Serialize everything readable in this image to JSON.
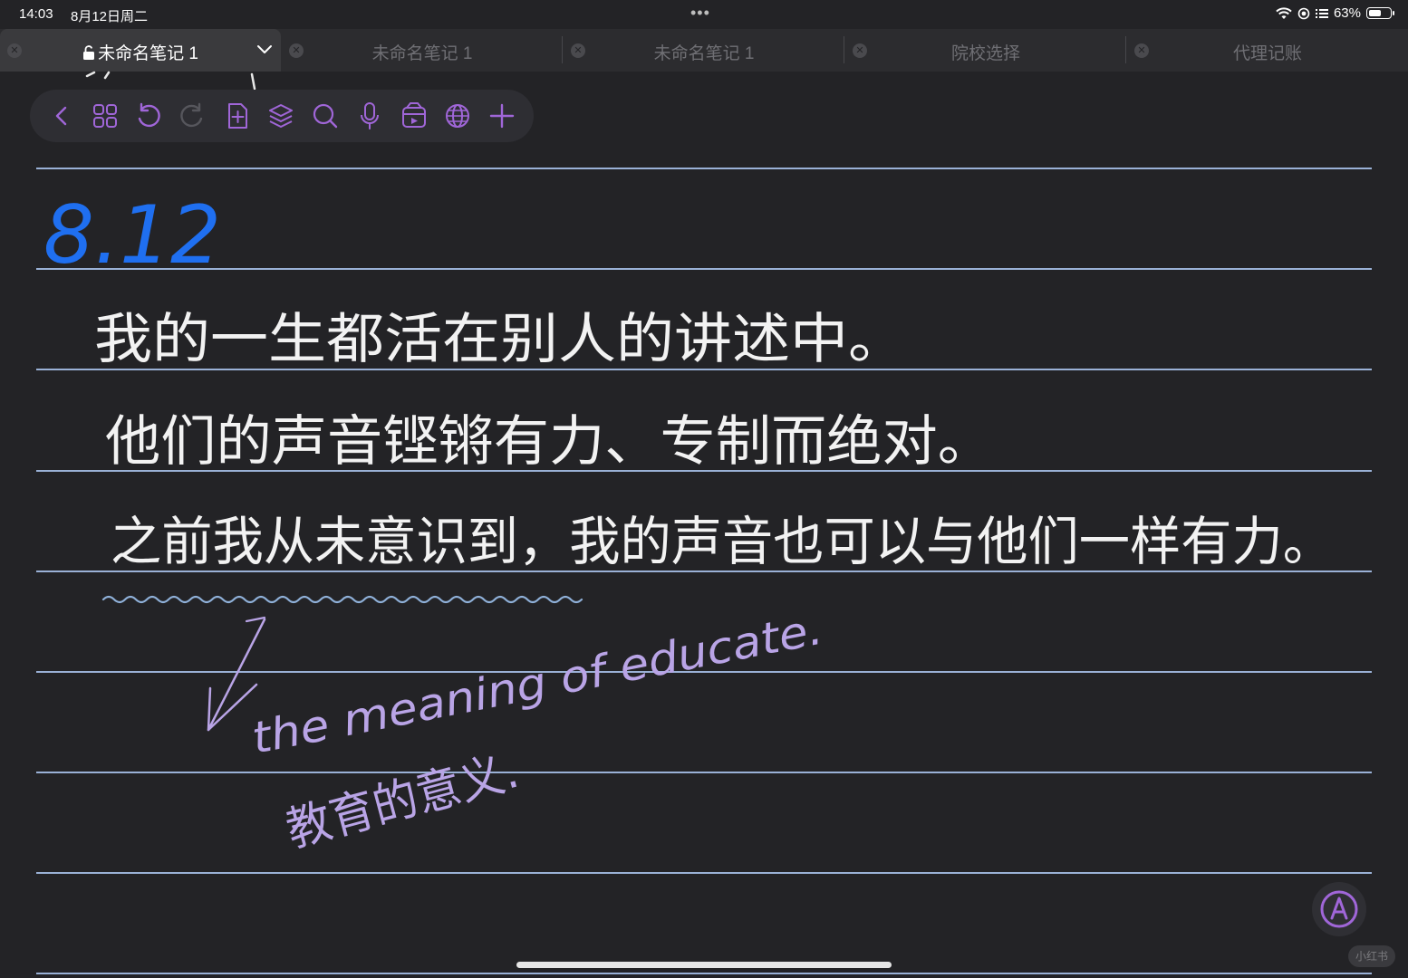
{
  "status": {
    "time": "14:03",
    "date": "8月12日周二",
    "battery": "63%",
    "battery_level": 0.63
  },
  "tabs": [
    {
      "label": "未命名笔记 1",
      "active": true
    },
    {
      "label": "未命名笔记 1",
      "active": false
    },
    {
      "label": "未命名笔记 1",
      "active": false
    },
    {
      "label": "院校选择",
      "active": false
    },
    {
      "label": "代理记账",
      "active": false
    }
  ],
  "toolbar_icons": [
    "back-icon",
    "grid-icon",
    "undo-icon",
    "redo-icon",
    "add-page-icon",
    "layers-icon",
    "search-icon",
    "microphone-icon",
    "media-icon",
    "globe-icon",
    "plus-icon"
  ],
  "note": {
    "date": "8.12",
    "lines": [
      "我的一生都活在别人的讲述中。",
      "他们的声音铿锵有力、专制而绝对。",
      "之前我从未意识到，我的声音也可以与他们一样有力。"
    ],
    "annotation_en": "the meaning of educate.",
    "annotation_zh": "教育的意义."
  },
  "watermark": "小红书",
  "colors": {
    "background": "#232326",
    "ruled_line": "#9ab1d6",
    "date_ink": "#1f6ff0",
    "text_ink": "#f2f2f2",
    "annotation_ink": "#b9a4e6",
    "wave_ink": "#8fb0d8",
    "toolbar_icon": "#a066d8"
  }
}
